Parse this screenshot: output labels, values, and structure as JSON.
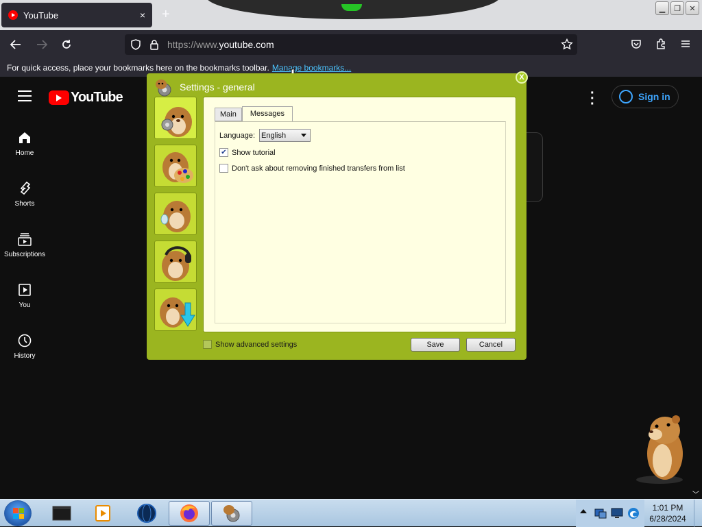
{
  "browser": {
    "tab_title": "YouTube",
    "tab_close": "×",
    "new_tab": "+",
    "url_prefix": "https://www.",
    "url_domain": "youtube.com",
    "bookmarks_text": "For quick access, place your bookmarks here on the bookmarks toolbar.",
    "bookmarks_link": "Manage bookmarks..."
  },
  "youtube": {
    "logo_text": "YouTube",
    "signin_label": "Sign in",
    "sidebar": [
      {
        "label": "Home",
        "icon": "home-icon"
      },
      {
        "label": "Shorts",
        "icon": "shorts-icon"
      },
      {
        "label": "Subscriptions",
        "icon": "subscriptions-icon"
      },
      {
        "label": "You",
        "icon": "you-icon"
      },
      {
        "label": "History",
        "icon": "history-icon"
      }
    ]
  },
  "dialog": {
    "title": "Settings - general",
    "close": "X",
    "tabs": [
      "Main",
      "Messages"
    ],
    "active_tab": "Messages",
    "language_label": "Language:",
    "language_value": "English",
    "show_tutorial_label": "Show tutorial",
    "show_tutorial_checked": true,
    "dont_ask_label": "Don't ask about removing finished transfers from list",
    "dont_ask_checked": false,
    "advanced_label": "Show advanced settings",
    "advanced_checked": false,
    "save_label": "Save",
    "cancel_label": "Cancel",
    "theme_color": "#9bb520"
  },
  "taskbar": {
    "time": "1:01 PM",
    "date": "6/28/2024"
  }
}
